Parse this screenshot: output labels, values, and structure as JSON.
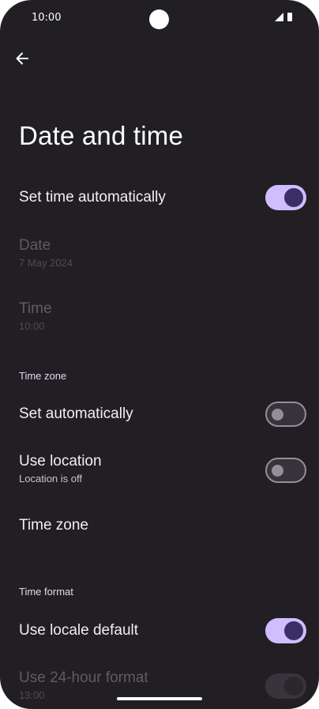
{
  "status_bar": {
    "time": "10:00"
  },
  "page": {
    "title": "Date and time"
  },
  "settings": {
    "set_time_automatically": {
      "label": "Set time automatically",
      "enabled": true
    },
    "date": {
      "label": "Date",
      "value": "7 May 2024"
    },
    "time": {
      "label": "Time",
      "value": "10:00"
    },
    "time_zone_section": "Time zone",
    "set_automatically": {
      "label": "Set automatically",
      "enabled": false
    },
    "use_location": {
      "label": "Use location",
      "summary": "Location is off",
      "enabled": false
    },
    "time_zone": {
      "label": "Time zone"
    },
    "time_format_section": "Time format",
    "use_locale_default": {
      "label": "Use locale default",
      "enabled": true
    },
    "use_24_hour": {
      "label": "Use 24-hour format",
      "summary": "13:00",
      "enabled": true
    }
  },
  "colors": {
    "background": "#211f24",
    "switch_on_track": "#cfbdfd",
    "switch_on_thumb": "#3b2e66",
    "switch_off_outline": "#938f99"
  },
  "icons": {
    "back": "arrow-left-icon",
    "signal": "signal-icon",
    "battery": "battery-icon"
  }
}
